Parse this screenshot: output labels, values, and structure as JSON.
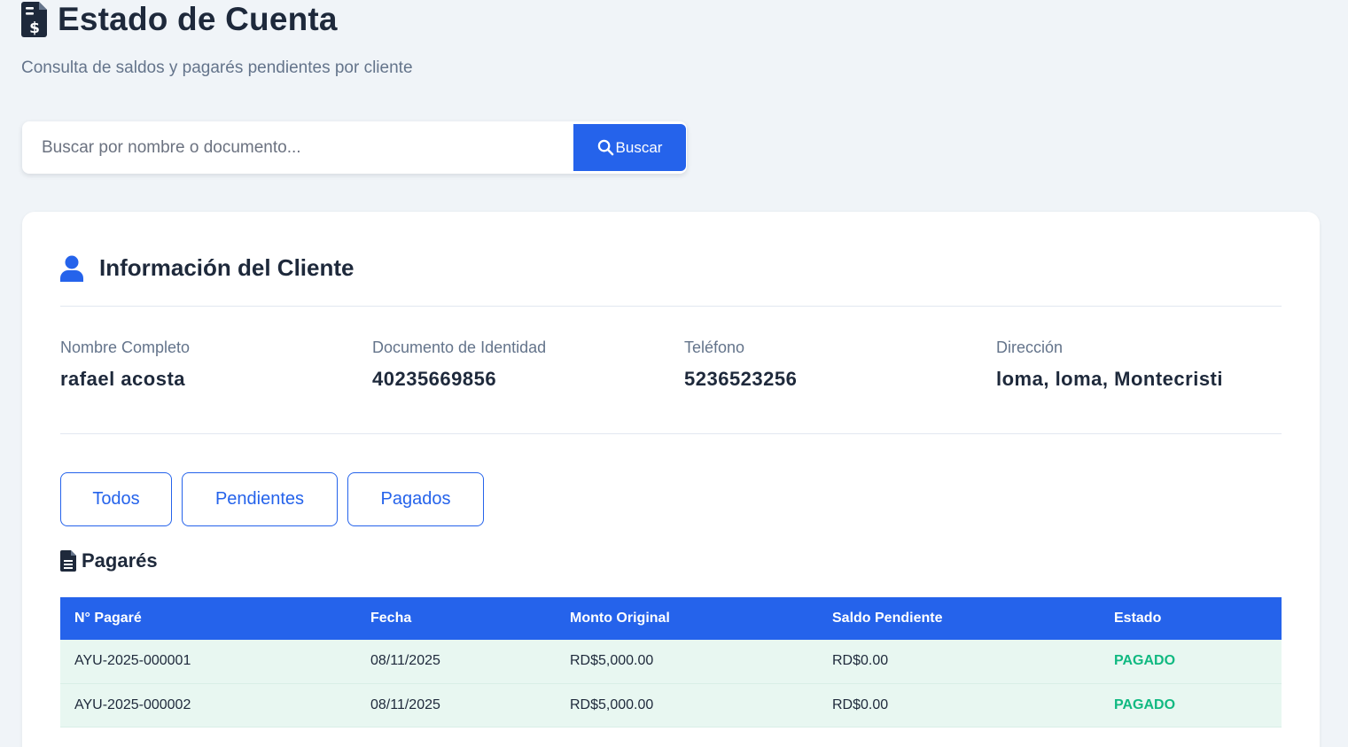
{
  "header": {
    "title": "Estado de Cuenta",
    "subtitle": "Consulta de saldos y pagarés pendientes por cliente"
  },
  "search": {
    "placeholder": "Buscar por nombre o documento...",
    "button_label": "Buscar"
  },
  "client_section": {
    "title": "Información del Cliente",
    "fields": [
      {
        "label": "Nombre Completo",
        "value": "rafael acosta"
      },
      {
        "label": "Documento de Identidad",
        "value": "40235669856"
      },
      {
        "label": "Teléfono",
        "value": "5236523256"
      },
      {
        "label": "Dirección",
        "value": "loma, loma, Montecristi"
      }
    ]
  },
  "filters": {
    "all_label": "Todos",
    "pending_label": "Pendientes",
    "paid_label": "Pagados"
  },
  "pagares": {
    "title": "Pagarés",
    "columns": [
      "N° Pagaré",
      "Fecha",
      "Monto Original",
      "Saldo Pendiente",
      "Estado"
    ],
    "rows": [
      {
        "numero": "AYU-2025-000001",
        "fecha": "08/11/2025",
        "monto": "RD$5,000.00",
        "saldo": "RD$0.00",
        "estado": "PAGADO"
      },
      {
        "numero": "AYU-2025-000002",
        "fecha": "08/11/2025",
        "monto": "RD$5,000.00",
        "saldo": "RD$0.00",
        "estado": "PAGADO"
      }
    ]
  },
  "icons": {
    "title": "invoice-dollar-icon",
    "search": "search-icon",
    "client": "user-icon",
    "pagares": "document-icon"
  },
  "colors": {
    "primary": "#2563eb",
    "paid": "#10b981",
    "row_bg": "#e8f7f1",
    "text": "#1e293b",
    "muted": "#64748b"
  }
}
